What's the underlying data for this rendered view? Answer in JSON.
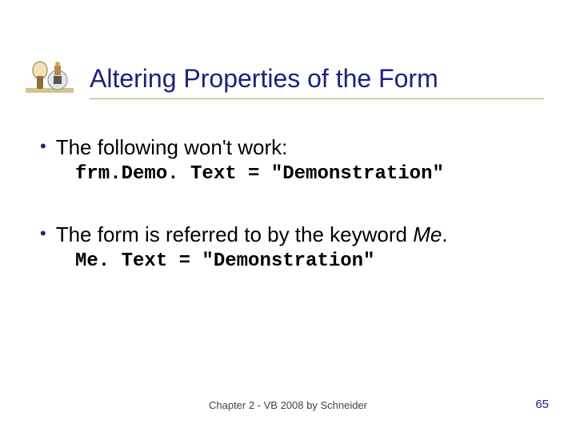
{
  "title": "Altering Properties of the Form",
  "bullets": [
    {
      "text": "The following won't work:",
      "code": "frm.Demo. Text = \"Demonstration\""
    },
    {
      "text_parts": [
        "The form is referred to by the keyword ",
        "Me",
        "."
      ],
      "code": "Me. Text = \"Demonstration\""
    }
  ],
  "footer": "Chapter 2 - VB 2008 by Schneider",
  "page_number": "65"
}
